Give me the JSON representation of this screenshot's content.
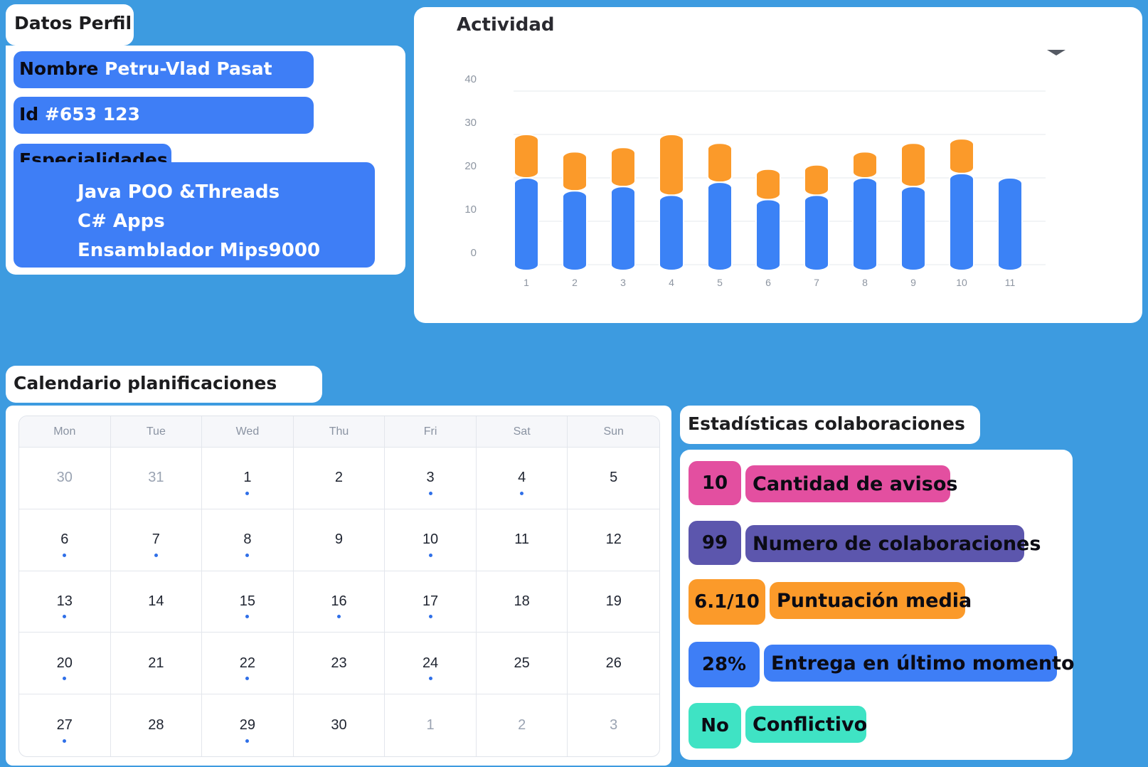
{
  "profile": {
    "section_title": "Datos Perfil",
    "name_key": "Nombre",
    "name_value": "Petru-Vlad Pasat",
    "id_key": "Id",
    "id_value": "#653  123",
    "specialties_title": "Especialidades",
    "specialties": [
      "Java POO &Threads",
      "C# Apps",
      "Ensamblador Mips9000"
    ]
  },
  "activity": {
    "title": "Actividad",
    "dropdown_icon": "chevron-down-icon"
  },
  "chart_data": {
    "type": "bar",
    "stacked": true,
    "categories": [
      "1",
      "2",
      "3",
      "4",
      "5",
      "6",
      "7",
      "8",
      "9",
      "10",
      "11"
    ],
    "y_ticks": [
      "0",
      "10",
      "20",
      "30",
      "40"
    ],
    "ylim": [
      0,
      40
    ],
    "grid": true,
    "series": [
      {
        "color": "#3b82f6",
        "values": [
          20,
          17,
          18,
          16,
          19,
          15,
          16,
          20,
          18,
          21,
          20
        ]
      },
      {
        "color": "#fb9a2a",
        "values": [
          10,
          9,
          9,
          14,
          9,
          7,
          7,
          6,
          10,
          8,
          0
        ]
      }
    ],
    "title": "",
    "xlabel": "",
    "ylabel": ""
  },
  "calendar": {
    "title": "Calendario planificaciones",
    "days": [
      "Mon",
      "Tue",
      "Wed",
      "Thu",
      "Fri",
      "Sat",
      "Sun"
    ],
    "weeks": [
      [
        {
          "d": "30",
          "muted": true
        },
        {
          "d": "31",
          "muted": true
        },
        {
          "d": "1",
          "dot": true
        },
        {
          "d": "2"
        },
        {
          "d": "3",
          "dot": true
        },
        {
          "d": "4",
          "dot": true
        },
        {
          "d": "5"
        }
      ],
      [
        {
          "d": "6",
          "dot": true
        },
        {
          "d": "7",
          "dot": true
        },
        {
          "d": "8",
          "dot": true
        },
        {
          "d": "9"
        },
        {
          "d": "10",
          "dot": true
        },
        {
          "d": "11"
        },
        {
          "d": "12"
        }
      ],
      [
        {
          "d": "13",
          "dot": true
        },
        {
          "d": "14"
        },
        {
          "d": "15",
          "dot": true
        },
        {
          "d": "16",
          "dot": true
        },
        {
          "d": "17",
          "dot": true
        },
        {
          "d": "18"
        },
        {
          "d": "19"
        }
      ],
      [
        {
          "d": "20",
          "dot": true
        },
        {
          "d": "21"
        },
        {
          "d": "22",
          "dot": true
        },
        {
          "d": "23"
        },
        {
          "d": "24",
          "dot": true
        },
        {
          "d": "25"
        },
        {
          "d": "26"
        }
      ],
      [
        {
          "d": "27",
          "dot": true
        },
        {
          "d": "28"
        },
        {
          "d": "29",
          "dot": true
        },
        {
          "d": "30"
        },
        {
          "d": "1",
          "muted": true
        },
        {
          "d": "2",
          "muted": true
        },
        {
          "d": "3",
          "muted": true
        }
      ]
    ]
  },
  "stats": {
    "title": "Estadísticas colaboraciones",
    "items": [
      {
        "value": "10",
        "label": "Cantidad de avisos",
        "color": "#e34fa0"
      },
      {
        "value": "99",
        "label": "Numero de colaboraciones",
        "color": "#5c56ad"
      },
      {
        "value": "6.1/10",
        "label": "Puntuación media",
        "color": "#fb9a2a"
      },
      {
        "value": "28%",
        "label": "Entrega en último momento",
        "color": "#3e7ef6"
      },
      {
        "value": "No",
        "label": "Conflictivo",
        "color": "#3fe3c4"
      }
    ]
  }
}
